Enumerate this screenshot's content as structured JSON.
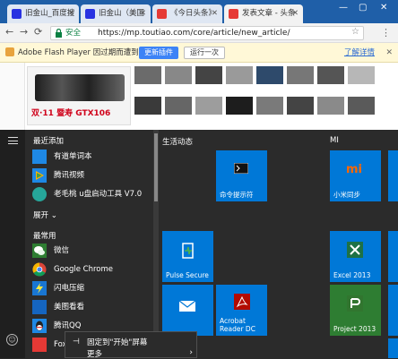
{
  "browser": {
    "tabs": [
      {
        "title": "旧金山_百度搜",
        "active": false
      },
      {
        "title": "旧金山（美国",
        "active": false
      },
      {
        "title": "《今日头条》",
        "active": false
      },
      {
        "title": "发表文章 - 头条",
        "active": true
      }
    ],
    "window_controls": [
      "—",
      "▢",
      "✕"
    ],
    "security_label": "安全",
    "url": "https://mp.toutiao.com/core/article/new_article/",
    "flash_bar": {
      "message": "Adobe Flash Player 因过期而遭到阻止",
      "update_button": "更新插件",
      "run_button": "运行一次",
      "learn_more": "了解详情"
    }
  },
  "web": {
    "promo_text": "双·11 暨寿 GTX106"
  },
  "start_menu": {
    "recently_added_header": "最近添加",
    "recently_added": [
      {
        "label": "有道单词本",
        "icon": "youdao-dict-icon"
      },
      {
        "label": "腾讯视频",
        "icon": "tencent-video-icon"
      },
      {
        "label": "老毛桃 u盘启动工具 V7.0",
        "icon": "laomaotao-icon"
      }
    ],
    "expand_label": "展开",
    "most_used_header": "最常用",
    "most_used": [
      {
        "label": "微信",
        "icon": "wechat-icon"
      },
      {
        "label": "Google Chrome",
        "icon": "chrome-icon"
      },
      {
        "label": "闪电压缩",
        "icon": "shandian-zip-icon"
      },
      {
        "label": "美图看看",
        "icon": "meitu-icon"
      },
      {
        "label": "腾讯QQ",
        "icon": "qq-icon"
      },
      {
        "label": "Fox",
        "icon": "foxit-icon"
      }
    ],
    "groups": [
      {
        "title": "生活动态"
      },
      {
        "title": "MI"
      }
    ],
    "tiles": [
      {
        "label": "命令提示符",
        "icon": "cmd-icon",
        "color": "#0078d7"
      },
      {
        "label": "小米同步",
        "icon": "mi-icon",
        "color": "#0078d7"
      },
      {
        "label": "Pulse Secure",
        "icon": "pulse-secure-icon",
        "color": "#0078d7"
      },
      {
        "label": "Excel 2013",
        "icon": "excel-icon",
        "color": "#0078d7"
      },
      {
        "label": "",
        "icon": "mail-icon",
        "color": "#0078d7"
      },
      {
        "label": "Acrobat Reader DC",
        "icon": "acrobat-icon",
        "color": "#0078d7"
      },
      {
        "label": "Project 2013",
        "icon": "project-icon",
        "color": "#2e7d32"
      }
    ],
    "context_menu": {
      "pin_label": "固定到\"开始\"屏幕",
      "more_label": "更多"
    }
  }
}
